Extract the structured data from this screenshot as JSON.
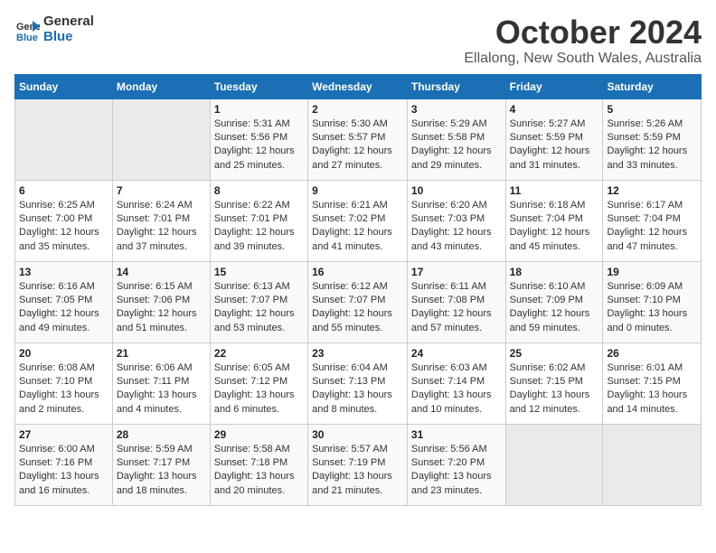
{
  "logo": {
    "line1": "General",
    "line2": "Blue"
  },
  "title": "October 2024",
  "location": "Ellalong, New South Wales, Australia",
  "weekdays": [
    "Sunday",
    "Monday",
    "Tuesday",
    "Wednesday",
    "Thursday",
    "Friday",
    "Saturday"
  ],
  "weeks": [
    [
      {
        "day": "",
        "content": ""
      },
      {
        "day": "",
        "content": ""
      },
      {
        "day": "1",
        "content": "Sunrise: 5:31 AM\nSunset: 5:56 PM\nDaylight: 12 hours\nand 25 minutes."
      },
      {
        "day": "2",
        "content": "Sunrise: 5:30 AM\nSunset: 5:57 PM\nDaylight: 12 hours\nand 27 minutes."
      },
      {
        "day": "3",
        "content": "Sunrise: 5:29 AM\nSunset: 5:58 PM\nDaylight: 12 hours\nand 29 minutes."
      },
      {
        "day": "4",
        "content": "Sunrise: 5:27 AM\nSunset: 5:59 PM\nDaylight: 12 hours\nand 31 minutes."
      },
      {
        "day": "5",
        "content": "Sunrise: 5:26 AM\nSunset: 5:59 PM\nDaylight: 12 hours\nand 33 minutes."
      }
    ],
    [
      {
        "day": "6",
        "content": "Sunrise: 6:25 AM\nSunset: 7:00 PM\nDaylight: 12 hours\nand 35 minutes."
      },
      {
        "day": "7",
        "content": "Sunrise: 6:24 AM\nSunset: 7:01 PM\nDaylight: 12 hours\nand 37 minutes."
      },
      {
        "day": "8",
        "content": "Sunrise: 6:22 AM\nSunset: 7:01 PM\nDaylight: 12 hours\nand 39 minutes."
      },
      {
        "day": "9",
        "content": "Sunrise: 6:21 AM\nSunset: 7:02 PM\nDaylight: 12 hours\nand 41 minutes."
      },
      {
        "day": "10",
        "content": "Sunrise: 6:20 AM\nSunset: 7:03 PM\nDaylight: 12 hours\nand 43 minutes."
      },
      {
        "day": "11",
        "content": "Sunrise: 6:18 AM\nSunset: 7:04 PM\nDaylight: 12 hours\nand 45 minutes."
      },
      {
        "day": "12",
        "content": "Sunrise: 6:17 AM\nSunset: 7:04 PM\nDaylight: 12 hours\nand 47 minutes."
      }
    ],
    [
      {
        "day": "13",
        "content": "Sunrise: 6:16 AM\nSunset: 7:05 PM\nDaylight: 12 hours\nand 49 minutes."
      },
      {
        "day": "14",
        "content": "Sunrise: 6:15 AM\nSunset: 7:06 PM\nDaylight: 12 hours\nand 51 minutes."
      },
      {
        "day": "15",
        "content": "Sunrise: 6:13 AM\nSunset: 7:07 PM\nDaylight: 12 hours\nand 53 minutes."
      },
      {
        "day": "16",
        "content": "Sunrise: 6:12 AM\nSunset: 7:07 PM\nDaylight: 12 hours\nand 55 minutes."
      },
      {
        "day": "17",
        "content": "Sunrise: 6:11 AM\nSunset: 7:08 PM\nDaylight: 12 hours\nand 57 minutes."
      },
      {
        "day": "18",
        "content": "Sunrise: 6:10 AM\nSunset: 7:09 PM\nDaylight: 12 hours\nand 59 minutes."
      },
      {
        "day": "19",
        "content": "Sunrise: 6:09 AM\nSunset: 7:10 PM\nDaylight: 13 hours\nand 0 minutes."
      }
    ],
    [
      {
        "day": "20",
        "content": "Sunrise: 6:08 AM\nSunset: 7:10 PM\nDaylight: 13 hours\nand 2 minutes."
      },
      {
        "day": "21",
        "content": "Sunrise: 6:06 AM\nSunset: 7:11 PM\nDaylight: 13 hours\nand 4 minutes."
      },
      {
        "day": "22",
        "content": "Sunrise: 6:05 AM\nSunset: 7:12 PM\nDaylight: 13 hours\nand 6 minutes."
      },
      {
        "day": "23",
        "content": "Sunrise: 6:04 AM\nSunset: 7:13 PM\nDaylight: 13 hours\nand 8 minutes."
      },
      {
        "day": "24",
        "content": "Sunrise: 6:03 AM\nSunset: 7:14 PM\nDaylight: 13 hours\nand 10 minutes."
      },
      {
        "day": "25",
        "content": "Sunrise: 6:02 AM\nSunset: 7:15 PM\nDaylight: 13 hours\nand 12 minutes."
      },
      {
        "day": "26",
        "content": "Sunrise: 6:01 AM\nSunset: 7:15 PM\nDaylight: 13 hours\nand 14 minutes."
      }
    ],
    [
      {
        "day": "27",
        "content": "Sunrise: 6:00 AM\nSunset: 7:16 PM\nDaylight: 13 hours\nand 16 minutes."
      },
      {
        "day": "28",
        "content": "Sunrise: 5:59 AM\nSunset: 7:17 PM\nDaylight: 13 hours\nand 18 minutes."
      },
      {
        "day": "29",
        "content": "Sunrise: 5:58 AM\nSunset: 7:18 PM\nDaylight: 13 hours\nand 20 minutes."
      },
      {
        "day": "30",
        "content": "Sunrise: 5:57 AM\nSunset: 7:19 PM\nDaylight: 13 hours\nand 21 minutes."
      },
      {
        "day": "31",
        "content": "Sunrise: 5:56 AM\nSunset: 7:20 PM\nDaylight: 13 hours\nand 23 minutes."
      },
      {
        "day": "",
        "content": ""
      },
      {
        "day": "",
        "content": ""
      }
    ]
  ]
}
